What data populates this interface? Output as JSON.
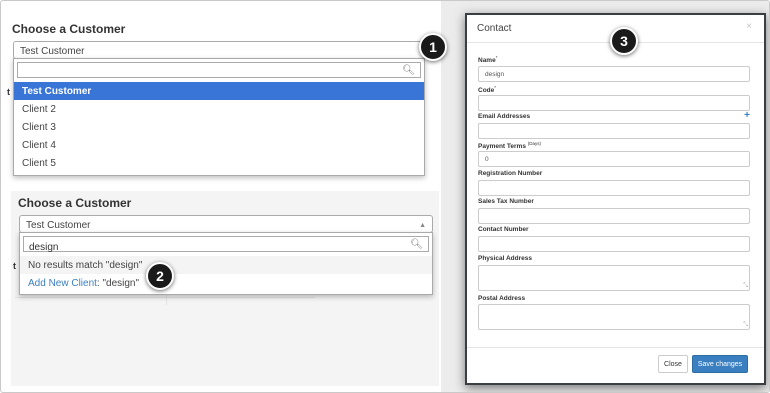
{
  "panel1": {
    "title": "Choose a Customer",
    "selected": "Test Customer",
    "search_value": "",
    "options": [
      "Test Customer",
      "Client 2",
      "Client 3",
      "Client 4",
      "Client 5"
    ]
  },
  "panel2": {
    "title": "Choose a Customer",
    "selected": "Test Customer",
    "search_value": "design",
    "no_results": "No results match \"design\"",
    "add_link": "Add New Client",
    "add_suffix": ": \"design\""
  },
  "badges": [
    "1",
    "2",
    "3"
  ],
  "modal": {
    "title": "Contact",
    "close_glyph": "×",
    "fields": {
      "name_label": "Name",
      "name_value": "design",
      "code_label": "Code",
      "code_value": "",
      "email_label": "Email Addresses",
      "payment_label": "Payment Terms",
      "payment_unit": "(Days)",
      "payment_value": "0",
      "registration_label": "Registration Number",
      "sales_tax_label": "Sales Tax Number",
      "contact_number_label": "Contact Number",
      "physical_label": "Physical Address",
      "postal_label": "Postal Address"
    },
    "required_mark": "*",
    "close_button": "Close",
    "save_button": "Save changes"
  },
  "colors": {
    "highlight": "#3875d7",
    "link": "#3a7fc0",
    "badge": "#1a1a1a"
  }
}
